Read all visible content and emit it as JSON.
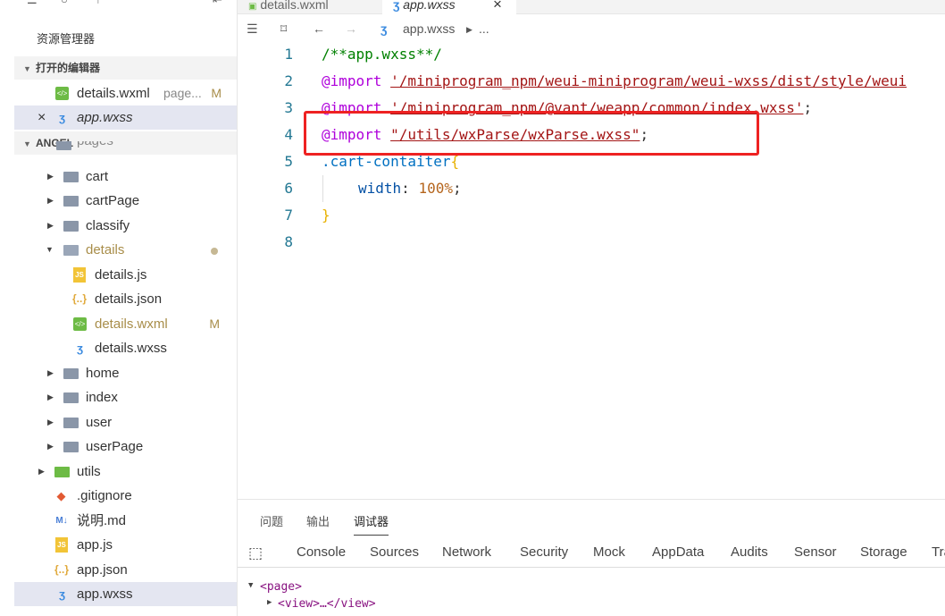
{
  "explorer": {
    "title": "资源管理器",
    "open_editors_label": "打开的编辑器",
    "open_editors": [
      {
        "name": "details.wxml",
        "hint": "page...",
        "badge": "M"
      },
      {
        "name": "app.wxss",
        "close": "×"
      }
    ],
    "workspace_label": "ANGEL",
    "partial_item": "pages",
    "tree": [
      {
        "label": "cart"
      },
      {
        "label": "cartPage"
      },
      {
        "label": "classify"
      },
      {
        "label": "details"
      },
      {
        "label": "details.js"
      },
      {
        "label": "details.json"
      },
      {
        "label": "details.wxml",
        "badge": "M"
      },
      {
        "label": "details.wxss"
      },
      {
        "label": "home"
      },
      {
        "label": "index"
      },
      {
        "label": "user"
      },
      {
        "label": "userPage"
      },
      {
        "label": "utils"
      },
      {
        "label": ".gitignore"
      },
      {
        "label": "说明.md"
      },
      {
        "label": "app.js"
      },
      {
        "label": "app.json"
      },
      {
        "label": "app.wxss"
      }
    ]
  },
  "tabs": [
    {
      "label": "details.wxml"
    },
    {
      "label": "app.wxss",
      "close": "×"
    }
  ],
  "breadcrumb": {
    "file": "app.wxss",
    "more": "..."
  },
  "code": {
    "line_numbers": [
      "1",
      "2",
      "3",
      "4",
      "5",
      "6",
      "7",
      "8"
    ],
    "l1": "/**app.wxss**/",
    "import_kw": "@import",
    "l2_str": "'/miniprogram_npm/weui-miniprogram/weui-wxss/dist/style/weui",
    "l3_str": "'/miniprogram_npm/@vant/weapp/common/index.wxss'",
    "l4_str": "\"/utils/wxParse/wxParse.wxss\"",
    "semi": ";",
    "l5_sel": ".cart-contaiter",
    "brace_open": "{",
    "l6_prop": "width",
    "l6_colon": ": ",
    "l6_val": "100%",
    "brace_close": "}"
  },
  "panel": {
    "tabs": [
      "问题",
      "输出",
      "调试器"
    ],
    "devtools_tabs": [
      "Console",
      "Sources",
      "Network",
      "Security",
      "Mock",
      "AppData",
      "Audits",
      "Sensor",
      "Storage",
      "Tra"
    ],
    "dom_line1": "<page>",
    "dom_line2": "<view>…</view>"
  }
}
